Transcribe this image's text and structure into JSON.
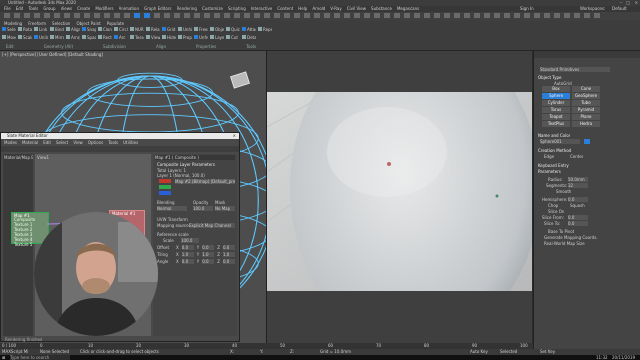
{
  "app": {
    "title": "Untitled - Autodesk 3ds Max 2020",
    "menu": [
      "File",
      "Edit",
      "Tools",
      "Group",
      "Views",
      "Create",
      "Modifiers",
      "Animation",
      "Graph Editors",
      "Rendering",
      "Customize",
      "Scripting",
      "Interactive",
      "Content",
      "Help",
      "Arnold",
      "V-Ray",
      "Civil View",
      "Substance",
      "Megascans"
    ],
    "workspace_label": "Workspaces:",
    "workspace_value": "Default",
    "user_label": "Sign In"
  },
  "ribbon": {
    "tabs": [
      "Modeling",
      "Freeform",
      "Selection",
      "Object Paint",
      "Populate"
    ],
    "groups": [
      "Edit",
      "Geometry (All)",
      "Subdivision",
      "Align",
      "Properties",
      "Tools"
    ],
    "buttons": [
      "Select",
      "Move",
      "Rotate",
      "Scale",
      "Link",
      "Unlink",
      "Bind",
      "Mirror",
      "Align",
      "Array",
      "Snapshot",
      "Spacing",
      "Clone",
      "Rectangle",
      "Circle",
      "Arc",
      "NURMS",
      "Tessellate",
      "Relax",
      "View",
      "Grid",
      "Hide",
      "Unhide",
      "Properties",
      "Freeze",
      "Unfreeze",
      "Object",
      "Layer",
      "Quick Slice",
      "Cut",
      "Attach",
      "Detach",
      "Repeat"
    ]
  },
  "viewport_left": {
    "label": "[+] [Perspective] [User Defined] [Default Shading]"
  },
  "slate": {
    "title": "Slate Material Editor",
    "menu": [
      "Modes",
      "Material",
      "Edit",
      "Select",
      "View",
      "Options",
      "Tools",
      "Utilities"
    ],
    "sidebar_label": "Material/Map Browser",
    "node_map_title": "Map #1",
    "node_map_sub": "Composite",
    "node_map_slots": [
      "Texture 1",
      "Texture 2",
      "Texture 3",
      "Texture 4",
      "Texture 5"
    ],
    "node_mat_title": "Material #1",
    "view_tab": "View1",
    "status": "Rendering finished"
  },
  "param_panel": {
    "header": "Map #1 ( Composite )",
    "title": "Composite Layer Parameters",
    "section_layers": "Total Layers: 1",
    "layer_line": "Layer 1 (Normal, 100.0)",
    "texture_label": "Map #2 (Bitmap) (Default_pref_...)",
    "blend_label": "Blending",
    "blend_mode": "Normal",
    "opacity_label": "Opacity",
    "opacity_value": "100.0",
    "mask_label": "Mask",
    "mask_value": "No Map",
    "uvw_label": "UVW Transform",
    "mapping_label": "Mapping source",
    "mapping_value": "Explicit Map Channel",
    "ref_label": "Reference scale",
    "scale_label": "Scale",
    "scale_value": "100.0",
    "offset_label": "Offset",
    "tiling_label": "Tiling",
    "angle_label": "Angle",
    "axis": [
      "X",
      "Y",
      "Z"
    ],
    "offset_vals": [
      "0.0",
      "0.0",
      "0.0"
    ],
    "tiling_vals": [
      "1.0",
      "1.0",
      "1.0"
    ],
    "angle_vals": [
      "0.0",
      "0.0",
      "0.0"
    ]
  },
  "right_panel": {
    "title": "Standard Primitives",
    "section_object_type": "Object Type",
    "autogrid": "AutoGrid",
    "prims": [
      "Box",
      "Cone",
      "Sphere",
      "GeoSphere",
      "Cylinder",
      "Tube",
      "Torus",
      "Pyramid",
      "Teapot",
      "Plane",
      "TextPlus",
      "Hedra"
    ],
    "section_name": "Name and Color",
    "name_value": "Sphere001",
    "section_creation": "Creation Method",
    "creation_opts": [
      "Edge",
      "Center"
    ],
    "section_keyboard": "Keyboard Entry",
    "section_params": "Parameters",
    "radius_label": "Radius:",
    "radius_value": "50.0mm",
    "segments_label": "Segments:",
    "segments_value": "32",
    "smooth_label": "Smooth",
    "hemisphere_label": "Hemisphere:",
    "hemisphere_value": "0.0",
    "chop_label": "Chop",
    "squash_label": "Squash",
    "slice_label": "Slice On",
    "slice_from_label": "Slice From:",
    "slice_from_value": "0.0",
    "slice_to_label": "Slice To:",
    "slice_to_value": "0.0",
    "base_label": "Base To Pivot",
    "gen_label": "Generate Mapping Coords.",
    "realworld_label": "Real-World Map Size"
  },
  "timeline": {
    "frame": "0 / 100",
    "ticks": [
      "0",
      "10",
      "20",
      "30",
      "40",
      "50",
      "60",
      "70",
      "80",
      "90",
      "100"
    ]
  },
  "status_bar": {
    "maxscript": "MAXScript Mi",
    "message": "Click or click-and-drag to select objects",
    "selected": "None Selected",
    "x_label": "X:",
    "y_label": "Y:",
    "z_label": "Z:",
    "grid": "Grid = 10.0mm",
    "autokey": "Auto Key",
    "selected_btn": "Selected",
    "setkey": "Set Key"
  },
  "taskbar": {
    "search": "Type here to search",
    "time": "11:32",
    "date": "20/11/2019"
  },
  "colors": {
    "accent": "#2b7fd8",
    "wire": "#5ec9ff",
    "red": "#c0392b",
    "green": "#2fa84f",
    "blue": "#2b5fd8"
  }
}
